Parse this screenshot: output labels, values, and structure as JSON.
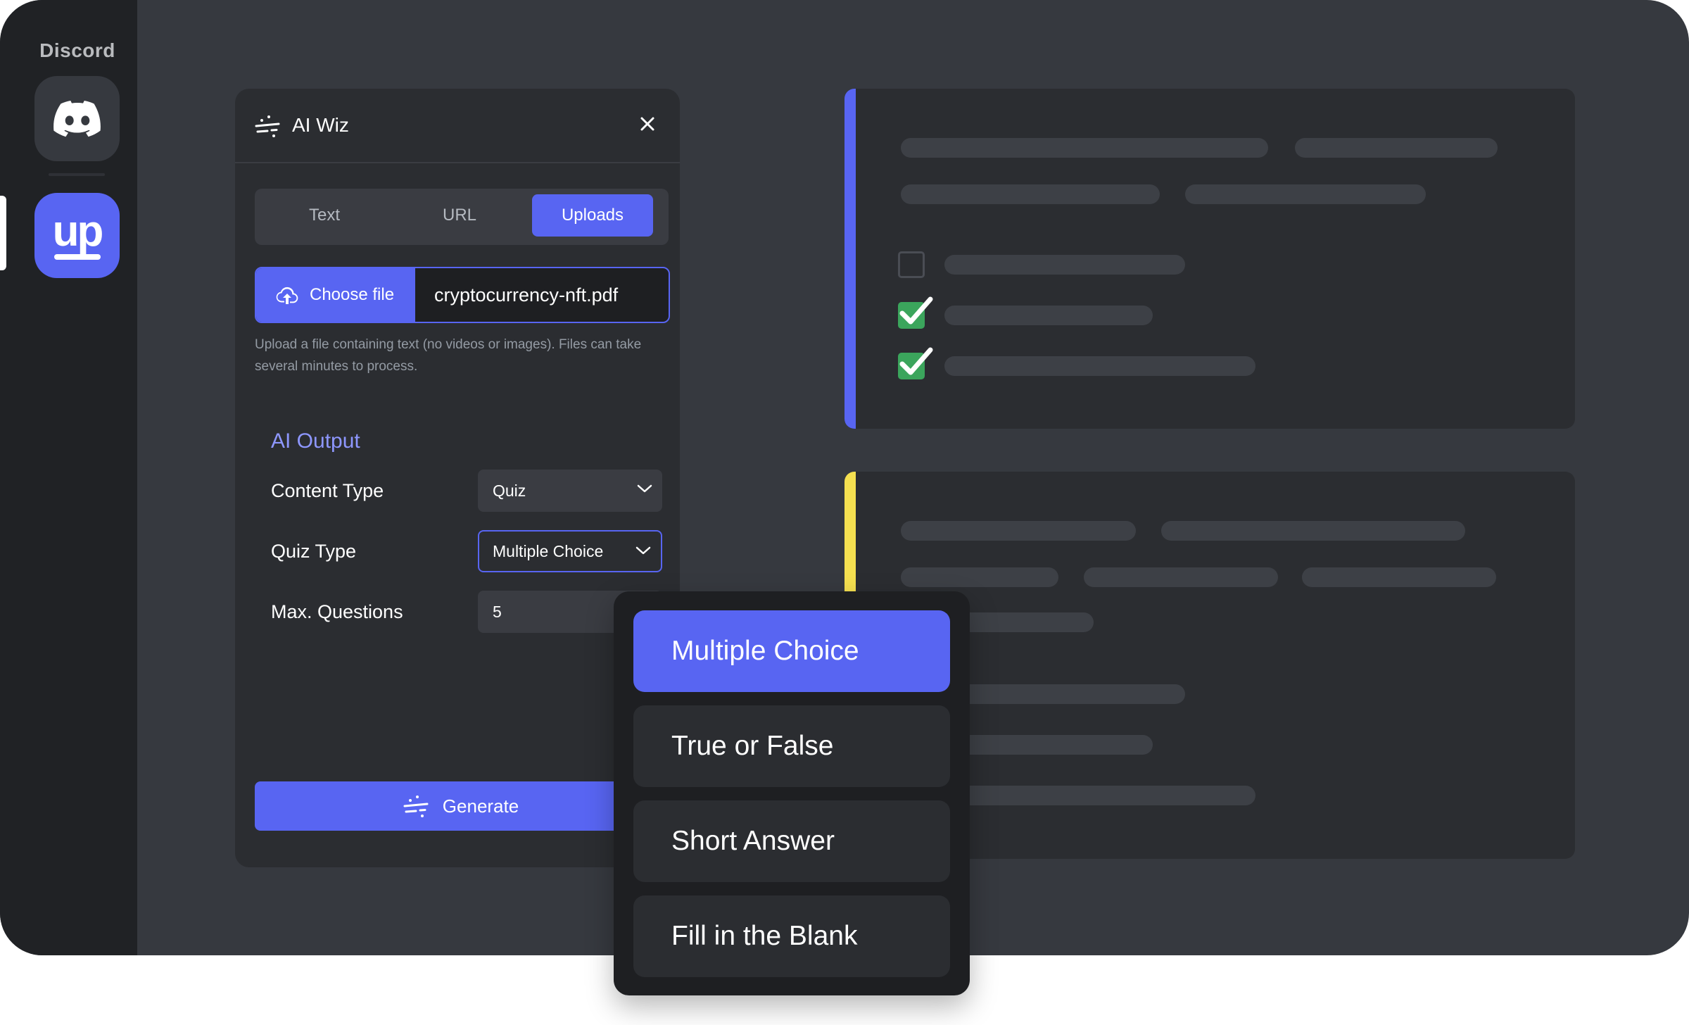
{
  "sidebar": {
    "title": "Discord",
    "servers": [
      {
        "name": "discord",
        "icon": "discord-icon"
      },
      {
        "name": "up",
        "label": "up",
        "icon": "up-logo-icon"
      }
    ]
  },
  "panel": {
    "title": "AI Wiz",
    "tabs": [
      {
        "label": "Text",
        "active": false
      },
      {
        "label": "URL",
        "active": false
      },
      {
        "label": "Uploads",
        "active": true
      }
    ],
    "upload": {
      "button_label": "Choose file",
      "file_name": "cryptocurrency-nft.pdf",
      "help_text": "Upload a file containing text (no videos or images). Files can take several minutes to process."
    },
    "output": {
      "section_title": "AI Output",
      "content_type_label": "Content Type",
      "content_type_value": "Quiz",
      "quiz_type_label": "Quiz Type",
      "quiz_type_value": "Multiple Choice",
      "max_questions_label": "Max. Questions",
      "max_questions_value": "5"
    },
    "generate_label": "Generate"
  },
  "dropdown": {
    "options": [
      {
        "label": "Multiple Choice",
        "selected": true
      },
      {
        "label": "True or False",
        "selected": false
      },
      {
        "label": "Short Answer",
        "selected": false
      },
      {
        "label": "Fill in the Blank",
        "selected": false
      }
    ]
  },
  "preview_cards": [
    {
      "accent_color": "#5865f2",
      "checkboxes": [
        false,
        true,
        true
      ]
    },
    {
      "accent_color": "#f5e050"
    }
  ],
  "colors": {
    "brand": "#5865f2",
    "success": "#3ba55c",
    "warning": "#f5e050",
    "link": "#8e97ff"
  }
}
